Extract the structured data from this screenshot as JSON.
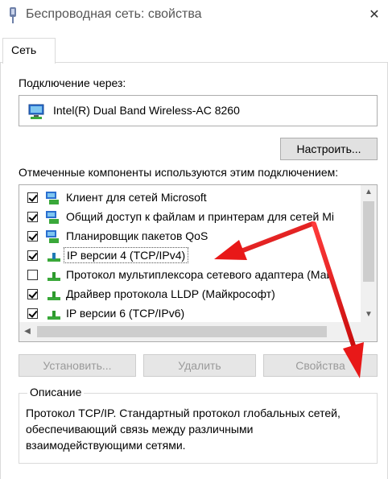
{
  "window": {
    "title": "Беспроводная сеть: свойства",
    "close_glyph": "✕"
  },
  "tabs": [
    {
      "label": "Сеть",
      "active": true
    }
  ],
  "connection": {
    "label": "Подключение через:",
    "adapter_name": "Intel(R) Dual Band Wireless-AC 8260",
    "adapter_icon": "network-adapter-icon",
    "configure_button": "Настроить..."
  },
  "components": {
    "label": "Отмеченные компоненты используются этим подключением:",
    "items": [
      {
        "label": "Клиент для сетей Microsoft",
        "checked": true,
        "icon": "network-client-icon"
      },
      {
        "label": "Общий доступ к файлам и принтерам для сетей Mi",
        "checked": true,
        "icon": "network-client-icon"
      },
      {
        "label": "Планировщик пакетов QoS",
        "checked": true,
        "icon": "network-client-icon"
      },
      {
        "label": "IP версии 4 (TCP/IPv4)",
        "checked": true,
        "icon": "protocol-icon",
        "selected": true
      },
      {
        "label": "Протокол мультиплексора сетевого адаптера (Май",
        "checked": false,
        "icon": "protocol-icon"
      },
      {
        "label": "Драйвер протокола LLDP (Майкрософт)",
        "checked": true,
        "icon": "protocol-icon"
      },
      {
        "label": "IP версии 6 (TCP/IPv6)",
        "checked": true,
        "icon": "protocol-icon"
      }
    ]
  },
  "buttons": {
    "install": "Установить...",
    "remove": "Удалить",
    "properties": "Свойства"
  },
  "description": {
    "legend": "Описание",
    "text": "Протокол TCP/IP. Стандартный протокол глобальных сетей, обеспечивающий связь между различными взаимодействующими сетями."
  },
  "colors": {
    "annotation_arrow": "#e81818",
    "protocol_icon": "#3aa83a",
    "client_icon": "#2a6fd0"
  }
}
